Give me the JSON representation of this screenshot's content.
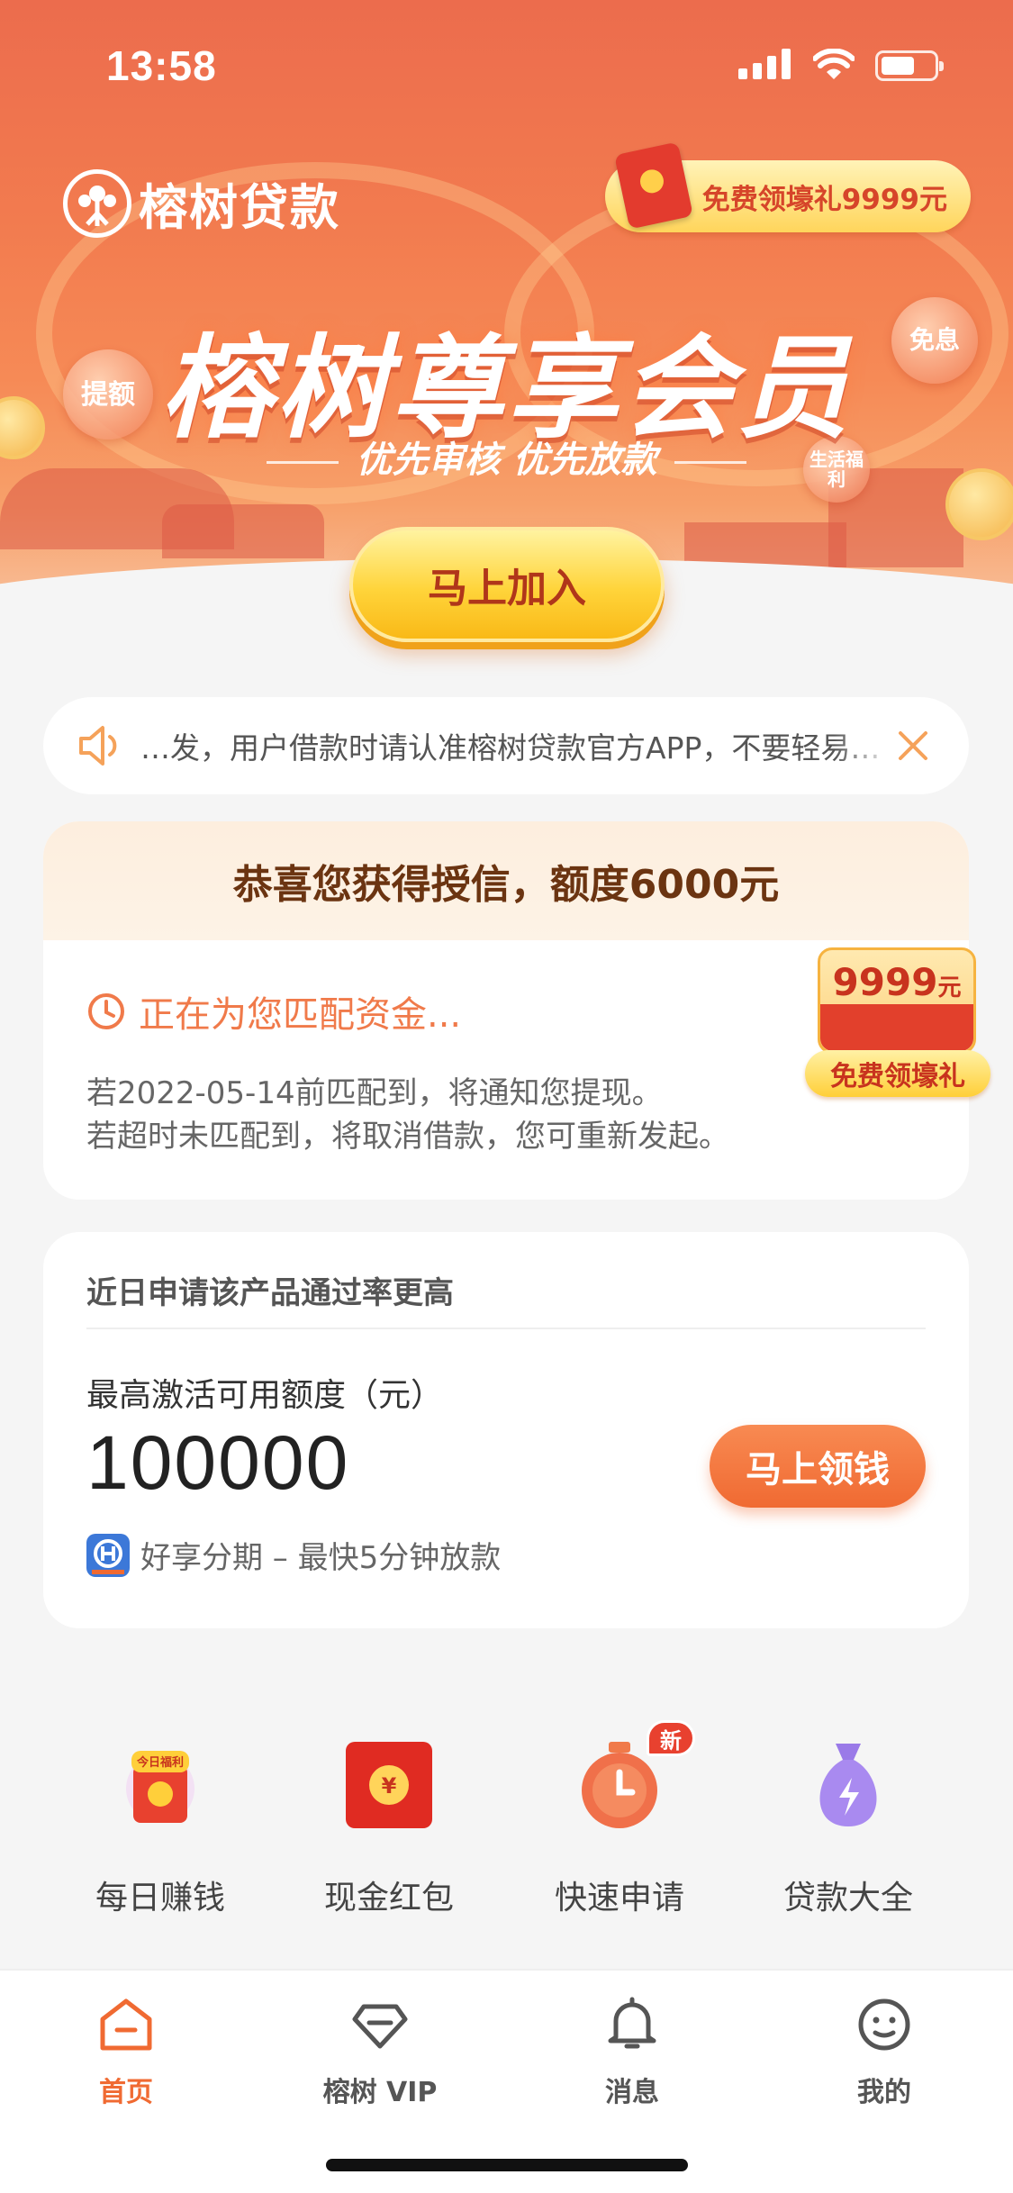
{
  "status_bar": {
    "time": "13:58"
  },
  "hero": {
    "brand_name": "榕树贷款",
    "gift_pill": "免费领壕礼9999元",
    "title": "榕树尊享会员",
    "subtitle": "优先审核 优先放款",
    "bubble_left": "提额",
    "bubble_right": "免息",
    "bubble_small": "生活福利",
    "join_button": "马上加入"
  },
  "notice": {
    "text": "…发，用户借款时请认准榕树贷款官方APP，不要轻易…"
  },
  "credit": {
    "headline": "恭喜您获得授信，额度6000元",
    "status": "正在为您匹配资金...",
    "note_line1": "若2022-05-14前匹配到，将通知您提现。",
    "note_line2": "若超时未匹配到，将取消借款，您可重新发起。",
    "badge_amount": "9999",
    "badge_unit": "元",
    "badge_label": "免费领壕礼"
  },
  "loan": {
    "tip": "近日申请该产品通过率更高",
    "label": "最高激活可用额度（元）",
    "amount": "100000",
    "button": "马上领钱",
    "provider": "好享分期 – 最快5分钟放款"
  },
  "entries": [
    {
      "label": "每日赚钱",
      "icon": "daily-gift-icon",
      "badge_text": "今日福利"
    },
    {
      "label": "现金红包",
      "icon": "red-envelope-icon",
      "badge_text": "¥"
    },
    {
      "label": "快速申请",
      "icon": "stopwatch-icon",
      "badge": "新"
    },
    {
      "label": "贷款大全",
      "icon": "money-bag-icon"
    }
  ],
  "tabs": [
    {
      "label": "首页",
      "icon": "home-icon",
      "active": true
    },
    {
      "label": "榕树 VIP",
      "icon": "diamond-icon",
      "active": false
    },
    {
      "label": "消息",
      "icon": "bell-icon",
      "active": false
    },
    {
      "label": "我的",
      "icon": "smiley-icon",
      "active": false
    }
  ],
  "colors": {
    "accent": "#f06a32",
    "hero_top": "#ec6c4d",
    "gold": "#ffd43a"
  }
}
